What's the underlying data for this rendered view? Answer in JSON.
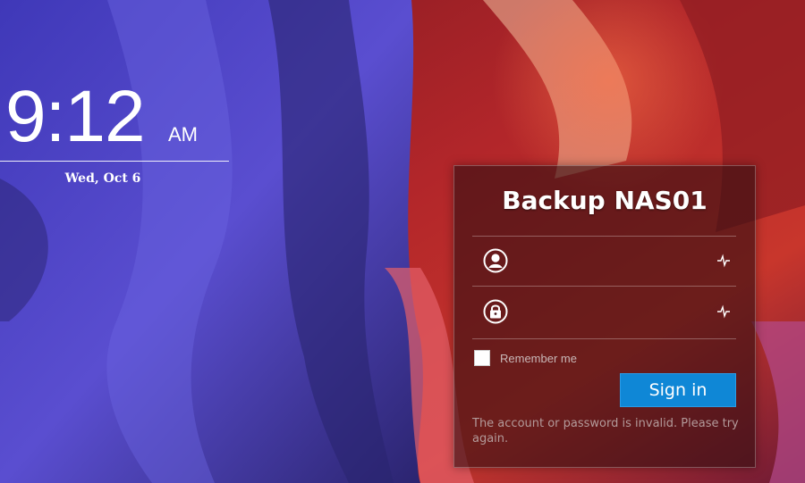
{
  "clock": {
    "time": "9:12",
    "ampm": "AM",
    "date": "Wed, Oct 6"
  },
  "login": {
    "title": "Backup NAS01",
    "username": {
      "value": "",
      "placeholder": "",
      "icon": "user-icon",
      "status_icon": "pulse-icon"
    },
    "password": {
      "value": "",
      "placeholder": "",
      "icon": "lock-icon",
      "status_icon": "pulse-icon"
    },
    "remember_label": "Remember me",
    "remember_checked": false,
    "signin_label": "Sign in",
    "error_message": "The account or password is invalid. Please try again."
  },
  "colors": {
    "signin_button": "#0f87d6",
    "panel_bg": "#340e12"
  }
}
